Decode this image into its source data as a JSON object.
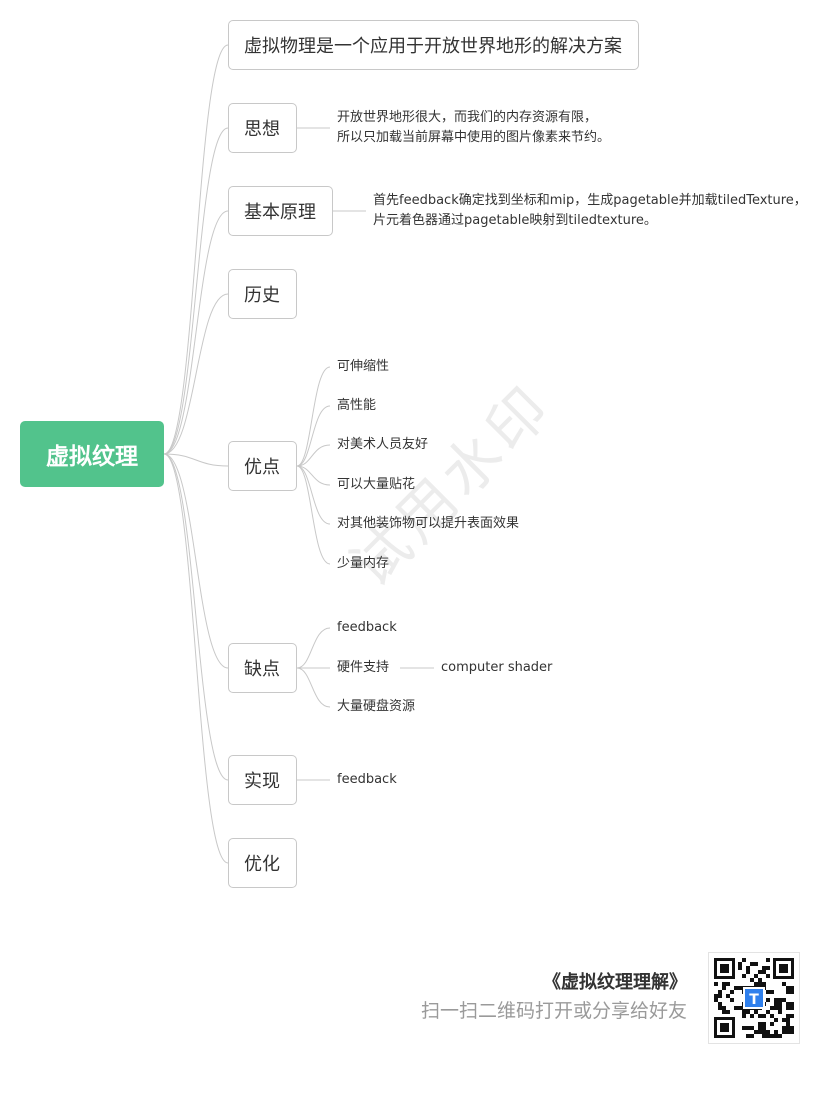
{
  "root": "虚拟纹理",
  "watermark": "试用水印",
  "branches": [
    {
      "label": "虚拟物理是一个应用于开放世界地形的解决方案"
    },
    {
      "label": "思想",
      "note": [
        "开放世界地形很大，而我们的内存资源有限，",
        "所以只加载当前屏幕中使用的图片像素来节约。"
      ]
    },
    {
      "label": "基本原理",
      "note": [
        "首先feedback确定找到坐标和mip，生成pagetable并加载tiledTexture，",
        "片元着色器通过pagetable映射到tiledtexture。"
      ]
    },
    {
      "label": "历史"
    },
    {
      "label": "优点",
      "children": [
        "可伸缩性",
        "高性能",
        "对美术人员友好",
        "可以大量贴花",
        "对其他装饰物可以提升表面效果",
        "少量内存"
      ]
    },
    {
      "label": "缺点",
      "children": [
        "feedback",
        "硬件支持",
        "大量硬盘资源"
      ],
      "grandchild": "computer shader"
    },
    {
      "label": "实现",
      "children": [
        "feedback"
      ]
    },
    {
      "label": "优化"
    }
  ],
  "footer": {
    "title": "《虚拟纹理理解》",
    "subtitle": "扫一扫二维码打开或分享给好友",
    "qr_icon": "qr-code-icon"
  },
  "colors": {
    "root": "#52c38c",
    "line": "#c8c8c8",
    "border": "#c8c8c8",
    "qr_badge": "#2f80ed"
  }
}
